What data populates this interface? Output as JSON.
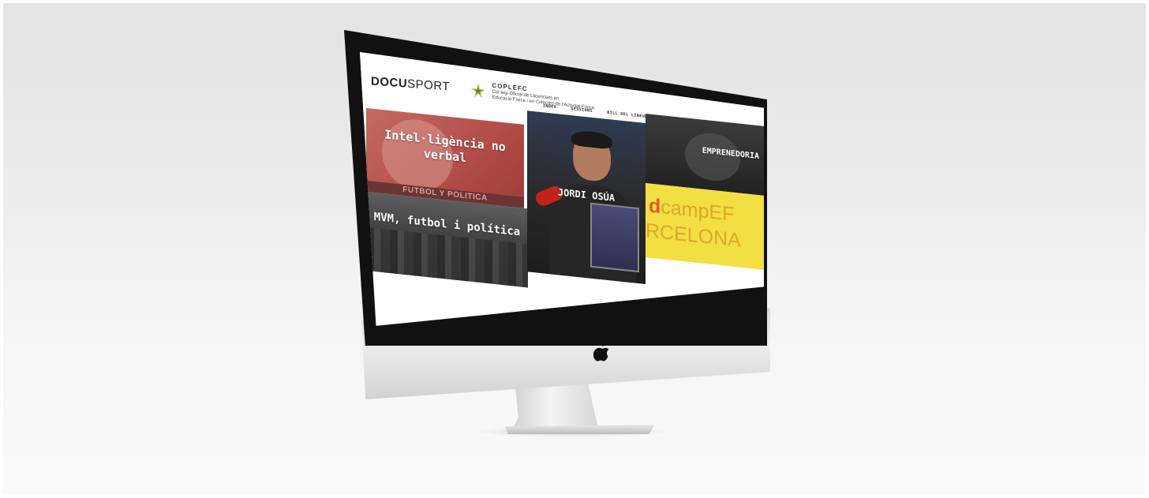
{
  "site": {
    "logo": {
      "bold": "DOCU",
      "light": "SPORT"
    },
    "partner": {
      "name": "COPLEFC",
      "subtitle_1": "Col·legi Oficial de Llicenciats en",
      "subtitle_2": "Educació Física i en Ciències de l'Activitat Física"
    },
    "nav": [
      "INDEX",
      "SESSIONS",
      "BILL DEL LINEUP"
    ],
    "tiles": {
      "tile_1": {
        "title": "Intel·ligència no verbal",
        "strip": "FUTBOL Y POLITICA"
      },
      "tile_2": {
        "title": "MVM, futbol i política"
      },
      "tile_3": {
        "title": "JORDI OSÚA"
      },
      "tile_4": {
        "title": "EMPRENEDORIA"
      },
      "tile_5": {
        "line_1_accent": "d",
        "line_1_rest": "campEF",
        "line_2": "RCELONA",
        "tag": ""
      }
    }
  },
  "colors": {
    "tile_1": "#b24d49",
    "tile_5": "#f2df42",
    "background": "#ececec",
    "bezel": "#111111"
  },
  "icons": {
    "device_logo": "apple-icon",
    "partner_logo": "star-icon"
  }
}
